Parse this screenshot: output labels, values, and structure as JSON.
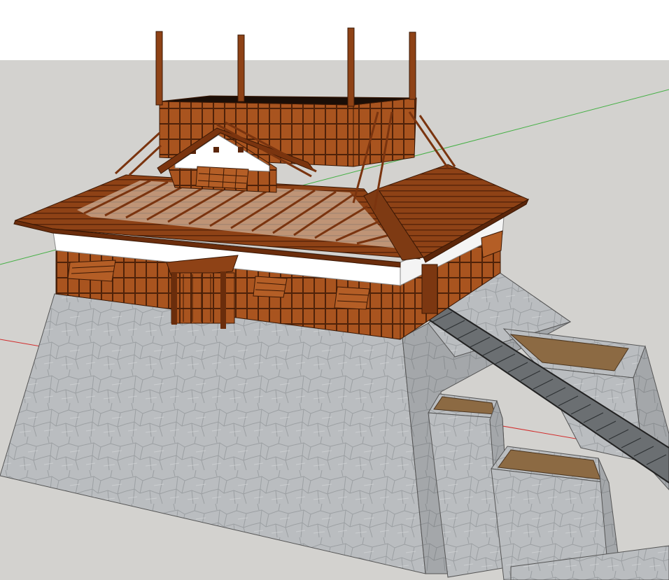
{
  "viewport": {
    "sky_color": "#ffffff",
    "ground_color": "#d3d2cf",
    "red_axis_color": "#d02a2a",
    "green_axis_color": "#3fae3f"
  },
  "model": {
    "stone_color": "#b9bcbf",
    "stone_shadow": "#9d9fa2",
    "wood_color": "#9a4a1e",
    "wood_dark": "#5c2a0e",
    "plaster_color": "#ffffff",
    "roof_color": "#8b3f17",
    "pad_color": "#8c6a43"
  }
}
